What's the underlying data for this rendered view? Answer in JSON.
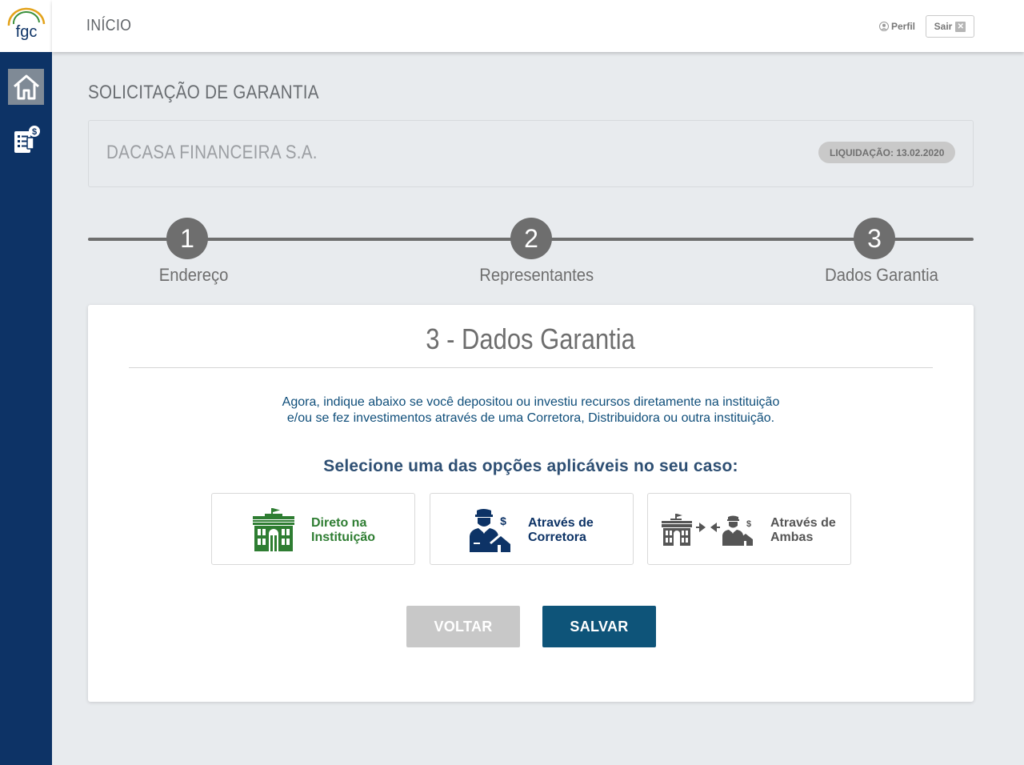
{
  "app": {
    "logo_text": "fgc"
  },
  "sidebar": {
    "items": [
      {
        "icon": "home-icon"
      },
      {
        "icon": "document-money-icon"
      }
    ]
  },
  "header": {
    "title": "INÍCIO",
    "perfil_label": "Perfil",
    "sair_label": "Sair"
  },
  "page": {
    "title": "SOLICITAÇÃO DE GARANTIA"
  },
  "institution": {
    "name": "DACASA FINANCEIRA S.A.",
    "liquidation_badge": "LIQUIDAÇÃO: 13.02.2020"
  },
  "stepper": {
    "steps": [
      {
        "number": "1",
        "label": "Endereço"
      },
      {
        "number": "2",
        "label": "Representantes"
      },
      {
        "number": "3",
        "label": "Dados Garantia"
      }
    ]
  },
  "panel": {
    "title": "3 - Dados Garantia",
    "intro_line1": "Agora, indique abaixo se você depositou ou investiu recursos diretamente na instituição",
    "intro_line2": "e/ou se fez investimentos através de uma Corretora, Distribuidora ou outra instituição.",
    "select_title": "Selecione uma das opções aplicáveis no seu caso:",
    "options": [
      {
        "line1": "Direto na",
        "line2": "Instituição",
        "color": "#2e7d32"
      },
      {
        "line1": "Através de",
        "line2": "Corretora",
        "color": "#0d3366"
      },
      {
        "line1": "Através de",
        "line2": "Ambas",
        "color": "#555555"
      }
    ],
    "voltar_label": "VOLTAR",
    "salvar_label": "SALVAR"
  },
  "colors": {
    "sidebar": "#0d3366",
    "primary_button": "#0e5479",
    "disabled_button": "#c8c8c8",
    "stepper": "#6e6e6e"
  }
}
